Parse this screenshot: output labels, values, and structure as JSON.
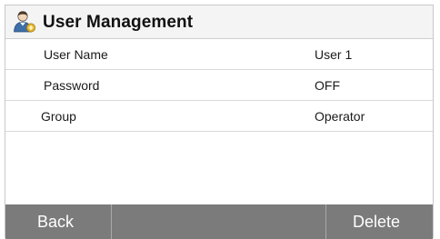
{
  "header": {
    "title": "User Management",
    "icon": "user-admin-icon"
  },
  "fields": [
    {
      "label": "User Name",
      "value": "User 1"
    },
    {
      "label": "Password",
      "value": "OFF"
    },
    {
      "label": "Group",
      "value": "Operator"
    }
  ],
  "footer": {
    "back_label": "Back",
    "delete_label": "Delete"
  },
  "colors": {
    "footer_bg": "#7b7b7b",
    "title_bg": "#f4f4f4",
    "icon_blue": "#3e6fa8",
    "icon_gold": "#e7b52a"
  }
}
